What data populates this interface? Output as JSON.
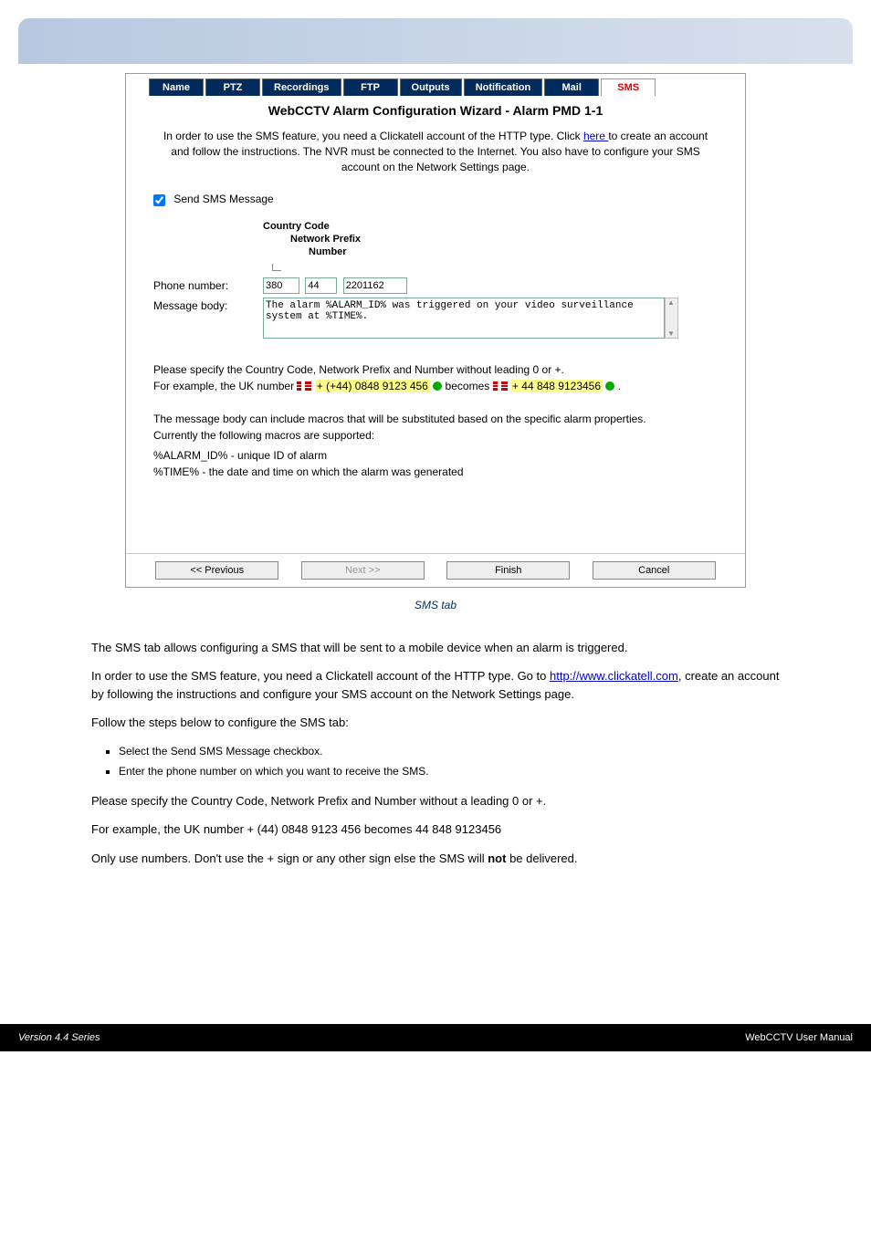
{
  "tabs": {
    "name": "Name",
    "ptz": "PTZ",
    "recordings": "Recordings",
    "ftp": "FTP",
    "outputs": "Outputs",
    "notification": "Notification",
    "mail": "Mail",
    "sms": "SMS"
  },
  "wizard_title": "WebCCTV Alarm Configuration Wizard - Alarm PMD 1-1",
  "instructions": {
    "part1": "In order to use the SMS feature, you need a Clickatell account of the HTTP type. Click ",
    "link": "here ",
    "part2": "to create an account and follow the instructions. The NVR must be connected to the Internet. You also have to configure your SMS account on the Network Settings page."
  },
  "checkbox_label": "Send SMS Message",
  "field_labels": {
    "country_code": "Country Code",
    "network_prefix": "Network Prefix",
    "number": "Number",
    "phone_number": "Phone number:",
    "message_body": "Message body:"
  },
  "values": {
    "cc": "380",
    "np": "44",
    "num": "2201162",
    "msg": "The alarm %ALARM_ID% was triggered on your video surveillance system at %TIME%."
  },
  "help": {
    "line1": "Please specify the Country Code, Network Prefix and Number without leading 0 or +.",
    "line2a": "For example, the UK number ",
    "line2_num1": "+ (+44) 0848 9123 456",
    "line2b": " becomes ",
    "line2_num2": "+ 44 848 9123456",
    "line3": "The message body can include macros that will be substituted based on the specific alarm properties.",
    "line4": "Currently the following macros are supported:",
    "macro1": "%ALARM_ID% - unique ID of alarm",
    "macro2": "%TIME% - the date and time on which the alarm was generated"
  },
  "buttons": {
    "previous": "<< Previous",
    "next": "Next >>",
    "finish": "Finish",
    "cancel": "Cancel"
  },
  "caption": "SMS tab",
  "body": {
    "p1": "The SMS tab allows configuring a SMS that will be sent to a mobile device when an alarm is triggered.",
    "p2a": "In order to use the SMS feature, you need a Clickatell account of the HTTP type. Go to ",
    "p2link": "http://www.clickatell.com",
    "p2b": ", create an account by following the instructions and configure your SMS account on the Network Settings page.",
    "p3": "Follow the steps below to configure the SMS tab:",
    "steps": [
      "Select the Send SMS Message checkbox.",
      "Enter the phone number on which you want to receive the SMS."
    ],
    "note1": "Please specify the Country Code, Network Prefix and Number without a leading 0 or +.",
    "note2": "For example, the UK number + (44) 0848 9123 456 becomes 44 848 9123456",
    "note3a": "Only use numbers. Don't use the + sign or any other sign else the SMS will ",
    "note3b": "not",
    "note3c": " be delivered."
  },
  "footer": {
    "left": "Version 4.4 Series",
    "right": "WebCCTV User Manual"
  }
}
